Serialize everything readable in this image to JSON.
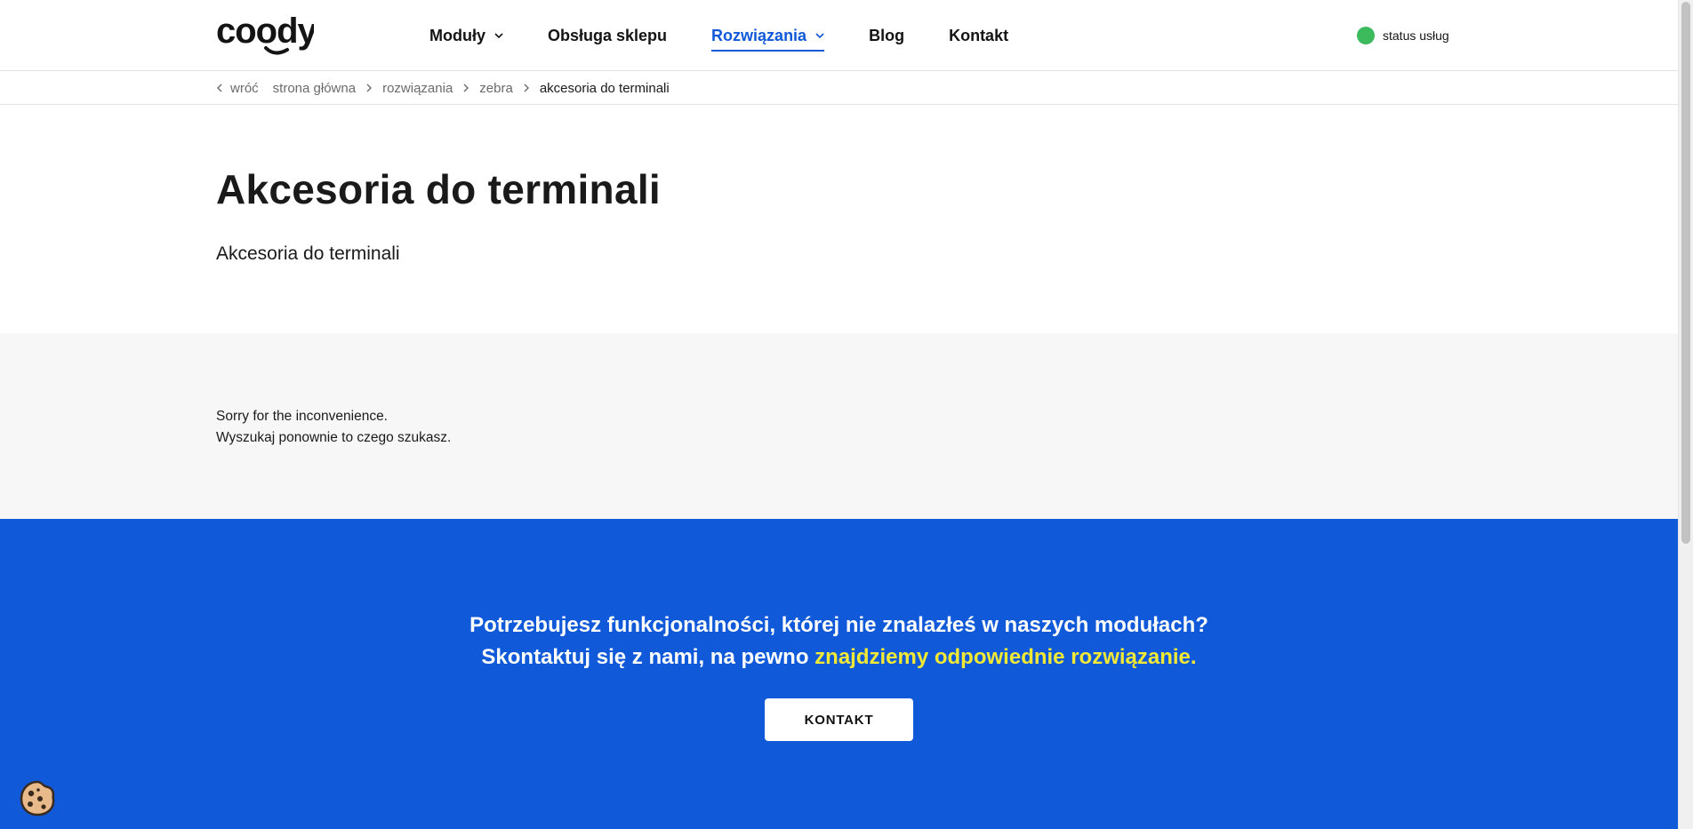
{
  "header": {
    "logo_text": "coody.",
    "nav": [
      {
        "label": "Moduły",
        "has_dropdown": true,
        "active": false
      },
      {
        "label": "Obsługa sklepu",
        "has_dropdown": false,
        "active": false
      },
      {
        "label": "Rozwiązania",
        "has_dropdown": true,
        "active": true
      },
      {
        "label": "Blog",
        "has_dropdown": false,
        "active": false
      },
      {
        "label": "Kontakt",
        "has_dropdown": false,
        "active": false
      }
    ],
    "status_label": "status usług",
    "status_color": "#3dba5c"
  },
  "breadcrumb": {
    "back_label": "wróć",
    "items": [
      "strona główna",
      "rozwiązania",
      "zebra"
    ],
    "current": "akcesoria do terminali"
  },
  "page": {
    "title": "Akcesoria do terminali",
    "subtitle": "Akcesoria do terminali"
  },
  "message": {
    "line1": "Sorry for the inconvenience.",
    "line2": "Wyszukaj ponownie to czego szukasz."
  },
  "cta": {
    "line1": "Potrzebujesz funkcjonalności, której nie znalazłeś w naszych modułach?",
    "line2_prefix": "Skontaktuj się z nami, na pewno ",
    "line2_highlight": "znajdziemy odpowiednie rozwiązanie.",
    "button_label": "KONTAKT",
    "bg_color": "#1059d9",
    "highlight_color": "#f2e936"
  },
  "icons": {
    "cookie": "cookie-icon",
    "chevron": "chevron-down-icon",
    "breadcrumb_sep": "chevron-right-icon",
    "back": "chevron-left-icon"
  }
}
